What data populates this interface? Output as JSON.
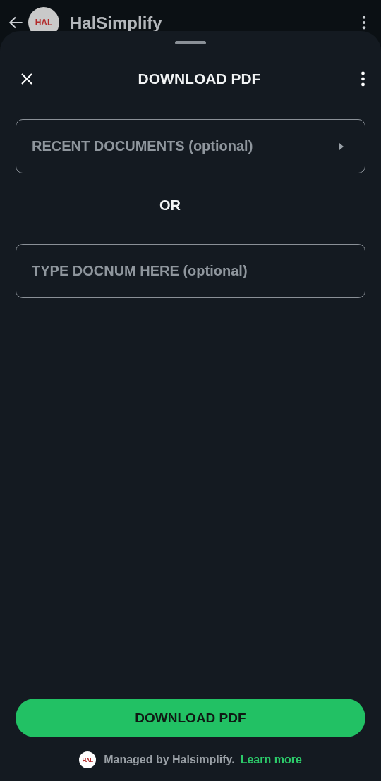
{
  "app_bar": {
    "avatar": "HAL",
    "title": "HalSimplify"
  },
  "sheet": {
    "title": "DOWNLOAD PDF",
    "fields": [
      {
        "kind": "dropdown",
        "placeholder": "RECENT DOCUMENTS (optional)"
      },
      {
        "kind": "separator",
        "text": "OR"
      },
      {
        "kind": "input",
        "placeholder": "TYPE DOCNUM HERE (optional)"
      }
    ],
    "button": "DOWNLOAD PDF",
    "footer": {
      "logo": "HAL",
      "text": "Managed by Halsimplify.",
      "link": "Learn more"
    }
  }
}
